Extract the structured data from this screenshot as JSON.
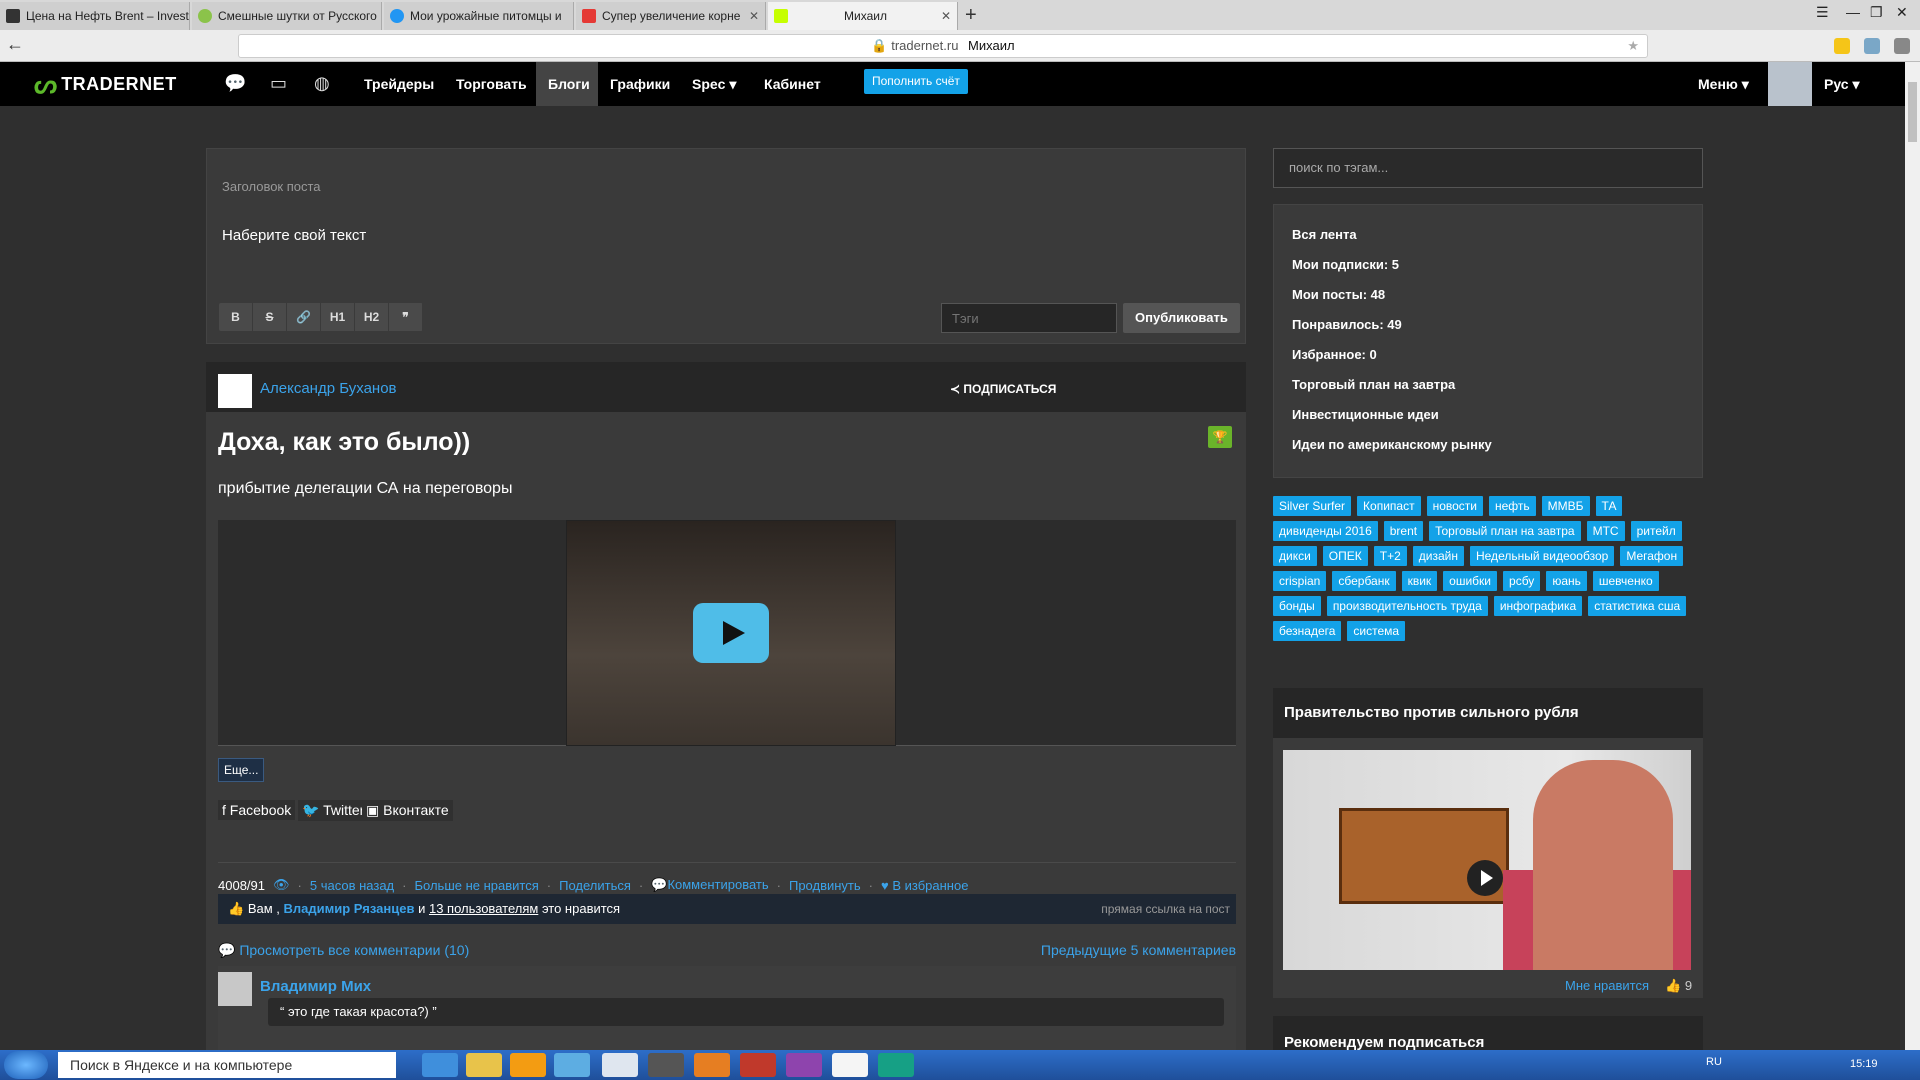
{
  "browser": {
    "tabs": [
      {
        "title": "Цена на Нефть Brent – Invest",
        "color": "#333"
      },
      {
        "title": "Смешные шутки от Русского",
        "color": "#8bc34a"
      },
      {
        "title": "Мои урожайные питомцы и",
        "color": "#2196f3"
      },
      {
        "title": "Супер увеличение корне",
        "color": "#e53935"
      },
      {
        "title": "Михаил",
        "color": "#c6ff00"
      }
    ],
    "new_tab": "+",
    "url": "tradernet.ru",
    "page_title": "Михаил"
  },
  "nav": {
    "logo": "TRADERNET",
    "links": [
      "Трейдеры",
      "Торговать",
      "Блоги",
      "Графики",
      "Spec",
      "Кабинет"
    ],
    "topup": "Пополнить счёт",
    "menu": "Меню",
    "lang": "Рус"
  },
  "editor": {
    "title_placeholder": "Заголовок поста",
    "text_placeholder": "Наберите свой текст",
    "toolbar": [
      "B",
      "S",
      "🔗",
      "H1",
      "H2",
      "❞"
    ],
    "tags_placeholder": "Тэги",
    "publish": "Опубликовать"
  },
  "post": {
    "author": "Александр Буханов",
    "subscribe": "ПОДПИСАТЬСЯ",
    "title": "Доха, как это было))",
    "subtitle": "прибытие делегации СА на переговоры",
    "more": "Еще...",
    "share": [
      "Facebook",
      "Twitter",
      "Вконтакте"
    ],
    "views": "4008/91",
    "time": "5 часов назад",
    "unlike": "Больше не нравится",
    "share_link": "Поделиться",
    "comment": "Комментировать",
    "promote": "Продвинуть",
    "favorite": "В избранное",
    "likes_prefix": "Вам ,",
    "likes_user": "Владимир Рязанцев",
    "likes_and": "и",
    "likes_count": "13 пользователям",
    "likes_suffix": "это нравится",
    "direct_link": "прямая ссылка на пост",
    "all_comments": "Просмотреть все комментарии (10)",
    "prev_comments": "Предыдущие 5 комментариев",
    "comment_author": "Владимир Мих",
    "comment_text": "“  это где такая красота?)  ”"
  },
  "sidebar": {
    "search_placeholder": "поиск по тэгам...",
    "feed": [
      "Вся лента",
      "Мои подписки: 5",
      "Мои посты: 48",
      "Понравилось: 49",
      "Избранное: 0",
      "Торговый план на завтра",
      "Инвестиционные идеи",
      "Идеи по американскому рынку"
    ],
    "tags": [
      "Silver Surfer",
      "Копипаст",
      "новости",
      "нефть",
      "ММВБ",
      "ТА",
      "дивиденды 2016",
      "brent",
      "Торговый план на завтра",
      "МТС",
      "ритейл",
      "дикси",
      "ОПЕК",
      "T+2",
      "дизайн",
      "Недельный видеообзор",
      "Мегафон",
      "crispian",
      "сбербанк",
      "квик",
      "ошибки",
      "рсбу",
      "юань",
      "шевченко",
      "бонды",
      "производительность труда",
      "инфографика",
      "статистика сша",
      "безнадега",
      "система"
    ],
    "promo_title": "Правительство против сильного рубля",
    "promo_like": "Мне нравится",
    "promo_count": "9",
    "recommend": "Рекомендуем подписаться"
  },
  "taskbar": {
    "search": "Поиск в Яндексе и на компьютере",
    "lang": "RU",
    "time": "15:19"
  }
}
